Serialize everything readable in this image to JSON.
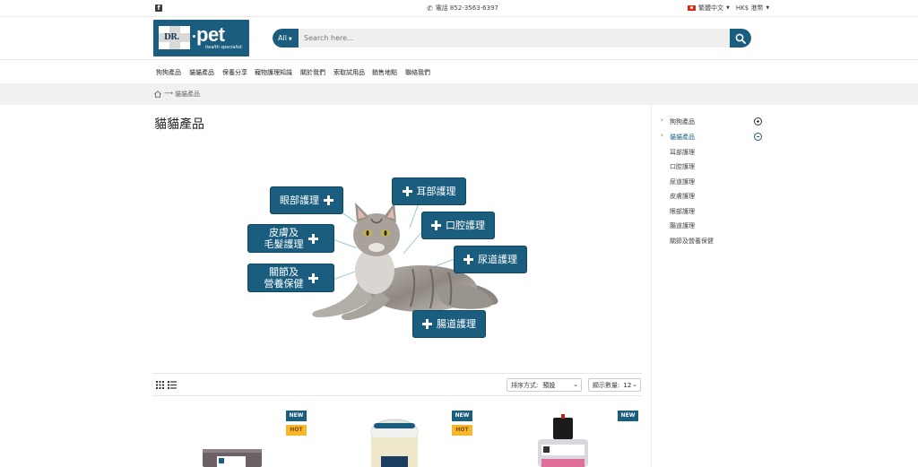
{
  "topbar": {
    "facebook_icon": "facebook-icon",
    "phone_label": "電話 852-3563-6397",
    "language": "繁體中文",
    "currency": "HK$ 港幣"
  },
  "header": {
    "logo": {
      "brand_left": "DR.",
      "brand_right": "pet",
      "tagline": "health specialist"
    },
    "search": {
      "category": "All",
      "placeholder": "Search here..."
    }
  },
  "nav": {
    "items": [
      {
        "label": "狗狗產品"
      },
      {
        "label": "貓貓產品"
      },
      {
        "label": "保養分享"
      },
      {
        "label": "寵物護理知識"
      },
      {
        "label": "關於我們"
      },
      {
        "label": "索取試用品"
      },
      {
        "label": "銷售地點"
      },
      {
        "label": "聯絡我們"
      }
    ]
  },
  "breadcrumb": {
    "arrow": "⟶",
    "current": "貓貓產品"
  },
  "page": {
    "title": "貓貓產品"
  },
  "banner": {
    "labels": {
      "eye": "眼部護理",
      "ear": "耳部護理",
      "skin_1": "皮膚及",
      "skin_2": "毛髮護理",
      "mouth": "口腔護理",
      "urinary": "尿道護理",
      "joint_1": "關節及",
      "joint_2": "營養保健",
      "intestine": "腸道護理"
    }
  },
  "toolbar": {
    "sort_label": "排序方式:",
    "sort_value": "預設",
    "show_label": "顯示數量:",
    "show_value": "12"
  },
  "products": [
    {
      "badges": [
        "NEW",
        "HOT"
      ]
    },
    {
      "badges": [
        "NEW",
        "HOT"
      ]
    },
    {
      "badges": [
        "NEW"
      ]
    }
  ],
  "sidebar": {
    "categories": [
      {
        "label": "狗狗產品",
        "active": false
      },
      {
        "label": "貓貓產品",
        "active": true
      }
    ],
    "subcategories": [
      {
        "label": "耳部護理"
      },
      {
        "label": "口腔護理"
      },
      {
        "label": "尿道護理"
      },
      {
        "label": "皮膚護理"
      },
      {
        "label": "眼部護理"
      },
      {
        "label": "腸道護理"
      },
      {
        "label": "關節及營養保健"
      }
    ]
  },
  "colors": {
    "brand": "#1a5d7e",
    "hot_badge": "#f6b72b"
  }
}
